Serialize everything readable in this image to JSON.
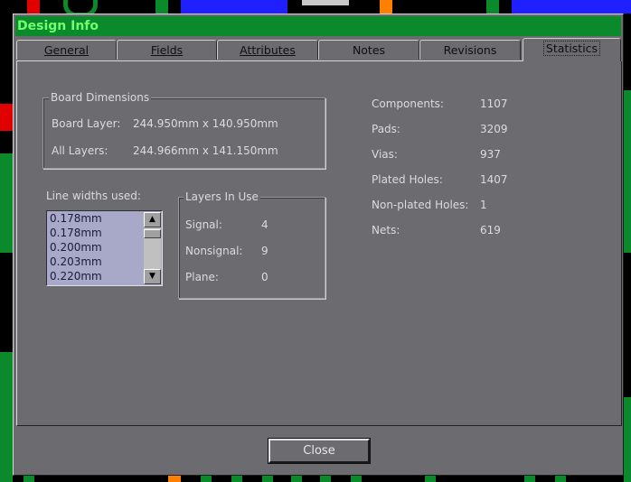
{
  "window": {
    "title": "Design Info"
  },
  "tabs": [
    {
      "label": "General"
    },
    {
      "label": "Fields"
    },
    {
      "label": "Attributes"
    },
    {
      "label": "Notes"
    },
    {
      "label": "Revisions"
    },
    {
      "label": "Statistics",
      "active": true
    }
  ],
  "board_dimensions": {
    "title": "Board Dimensions",
    "board_layer_label": "Board Layer:",
    "board_layer_value": "244.950mm x 140.950mm",
    "all_layers_label": "All Layers:",
    "all_layers_value": "244.966mm x 141.150mm"
  },
  "line_widths": {
    "label": "Line widths used:",
    "items": [
      "0.178mm",
      "0.178mm",
      "0.200mm",
      "0.203mm",
      "0.220mm"
    ]
  },
  "layers_in_use": {
    "title": "Layers In Use",
    "rows": [
      {
        "label": "Signal:",
        "value": "4"
      },
      {
        "label": "Nonsignal:",
        "value": "9"
      },
      {
        "label": "Plane:",
        "value": "0"
      }
    ]
  },
  "stats": [
    {
      "label": "Components:",
      "value": "1107"
    },
    {
      "label": "Pads:",
      "value": "3209"
    },
    {
      "label": "Vias:",
      "value": "937"
    },
    {
      "label": "Plated Holes:",
      "value": "1407"
    },
    {
      "label": "Non-plated Holes:",
      "value": "1"
    },
    {
      "label": "Nets:",
      "value": "619"
    }
  ],
  "buttons": {
    "close_label": "Close"
  },
  "colors": {
    "titlebar": "#0a8a2a",
    "title_text": "#6fff6f",
    "dialog_bg": "#6b6b70",
    "listbox_bg": "#a8a8c8"
  }
}
